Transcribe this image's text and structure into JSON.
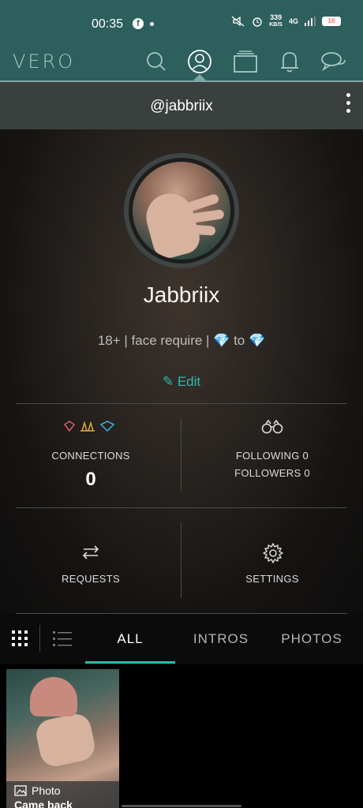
{
  "status_bar": {
    "time": "00:35",
    "network_speed_value": "339",
    "network_speed_unit": "KB/S",
    "network_type": "4G",
    "battery": "16"
  },
  "nav": {
    "logo": "VERO",
    "icons": [
      "search-icon",
      "profile-icon",
      "collections-icon",
      "bell-icon",
      "chat-icon"
    ],
    "active_icon": "profile-icon"
  },
  "header": {
    "handle": "@jabbriix"
  },
  "profile": {
    "name": "Jabbriix",
    "bio_text_1": "18+ | face require | ",
    "bio_gem_1": "💎",
    "bio_text_2": " to ",
    "bio_gem_2": "💎",
    "edit_label": "Edit"
  },
  "stats": {
    "connections_label": "CONNECTIONS",
    "connections_value": "0",
    "following_label": "FOLLOWING",
    "following_value": "0",
    "followers_label": "FOLLOWERS",
    "followers_value": "0",
    "requests_label": "REQUESTS",
    "settings_label": "SETTINGS"
  },
  "tabs": {
    "items": [
      "ALL",
      "INTROS",
      "PHOTOS"
    ],
    "active": "ALL"
  },
  "posts": [
    {
      "type": "Photo",
      "title": "Came back"
    }
  ],
  "colors": {
    "header_bg": "#2d5f5c",
    "accent": "#2fb9b0",
    "gem": "#38b5e8"
  }
}
